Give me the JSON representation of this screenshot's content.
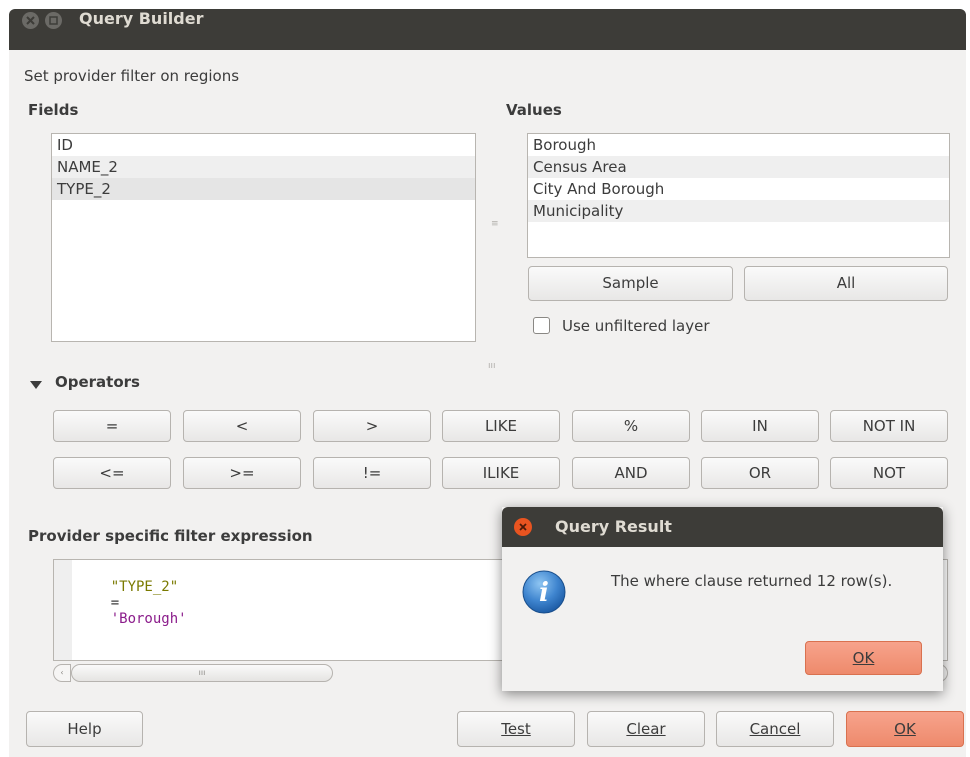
{
  "window": {
    "title": "Query Builder"
  },
  "subtitle": "Set provider filter on regions",
  "fields": {
    "label": "Fields",
    "items": [
      "ID",
      "NAME_2",
      "TYPE_2"
    ]
  },
  "values": {
    "label": "Values",
    "items": [
      "Borough",
      "Census Area",
      "City And Borough",
      "Municipality"
    ],
    "sample_label": "Sample",
    "all_label": "All",
    "unfiltered_label": "Use unfiltered layer"
  },
  "operators": {
    "label": "Operators",
    "row1": [
      "=",
      "<",
      ">",
      "LIKE",
      "%",
      "IN",
      "NOT IN"
    ],
    "row2": [
      "<=",
      ">=",
      "!=",
      "ILIKE",
      "AND",
      "OR",
      "NOT"
    ]
  },
  "expression": {
    "label": "Provider specific filter expression",
    "field": "\"TYPE_2\"",
    "op": "=",
    "value": "'Borough'"
  },
  "buttons": {
    "help": "Help",
    "test": "Test",
    "clear": "Clear",
    "cancel": "Cancel",
    "ok": "OK"
  },
  "popup": {
    "title": "Query Result",
    "message": "The where clause returned 12 row(s).",
    "ok": "OK"
  },
  "colors": {
    "accent": "#ee8a6c",
    "titlebar": "#3d3c38",
    "close": "#e95420",
    "string": "#8b1c8b",
    "field": "#7a7a00"
  }
}
